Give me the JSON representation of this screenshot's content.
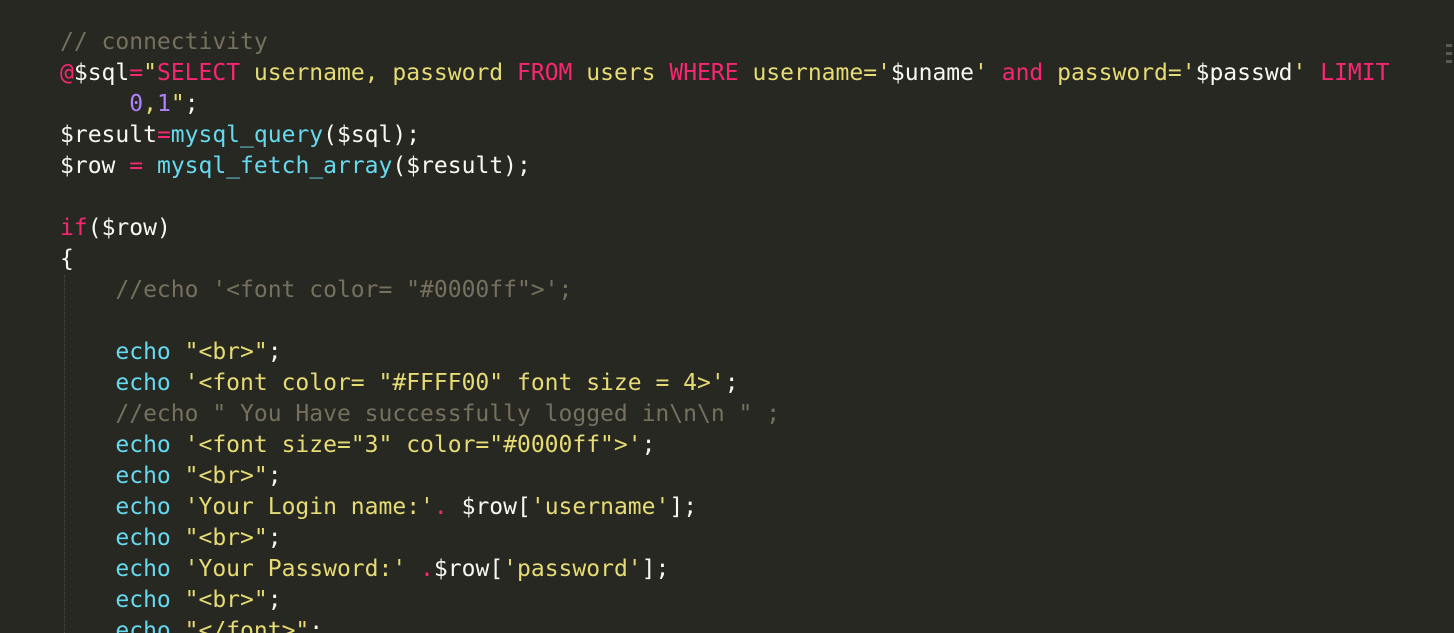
{
  "editor": {
    "theme_colors": {
      "background": "#272822",
      "foreground": "#f8f8f2",
      "comment": "#75715e",
      "keyword": "#f92672",
      "function": "#66d9ef",
      "string": "#e6db74",
      "number": "#ae81ff"
    },
    "lines": [
      {
        "tokens": [
          {
            "type": "comment",
            "text": "// connectivity"
          }
        ]
      },
      {
        "tokens": [
          {
            "type": "op",
            "text": "@"
          },
          {
            "type": "var",
            "text": "$sql"
          },
          {
            "type": "op",
            "text": "="
          },
          {
            "type": "string",
            "text": "\""
          },
          {
            "type": "keyword",
            "text": "SELECT"
          },
          {
            "type": "string",
            "text": " username, password "
          },
          {
            "type": "keyword",
            "text": "FROM"
          },
          {
            "type": "string",
            "text": " users "
          },
          {
            "type": "keyword",
            "text": "WHERE"
          },
          {
            "type": "string",
            "text": " username='"
          },
          {
            "type": "var",
            "text": "$uname"
          },
          {
            "type": "string",
            "text": "' "
          },
          {
            "type": "keyword",
            "text": "and"
          },
          {
            "type": "string",
            "text": " password='"
          },
          {
            "type": "var",
            "text": "$passwd"
          },
          {
            "type": "string",
            "text": "' "
          },
          {
            "type": "keyword",
            "text": "LIMIT"
          }
        ]
      },
      {
        "tokens": [
          {
            "type": "plain",
            "text": "     "
          },
          {
            "type": "number",
            "text": "0"
          },
          {
            "type": "string",
            "text": ","
          },
          {
            "type": "number",
            "text": "1"
          },
          {
            "type": "string",
            "text": "\""
          },
          {
            "type": "punct",
            "text": ";"
          }
        ]
      },
      {
        "tokens": [
          {
            "type": "var",
            "text": "$result"
          },
          {
            "type": "op",
            "text": "="
          },
          {
            "type": "func",
            "text": "mysql_query"
          },
          {
            "type": "punct",
            "text": "("
          },
          {
            "type": "var",
            "text": "$sql"
          },
          {
            "type": "punct",
            "text": ");"
          }
        ]
      },
      {
        "tokens": [
          {
            "type": "var",
            "text": "$row"
          },
          {
            "type": "plain",
            "text": " "
          },
          {
            "type": "op",
            "text": "="
          },
          {
            "type": "plain",
            "text": " "
          },
          {
            "type": "func",
            "text": "mysql_fetch_array"
          },
          {
            "type": "punct",
            "text": "("
          },
          {
            "type": "var",
            "text": "$result"
          },
          {
            "type": "punct",
            "text": ");"
          }
        ]
      },
      {
        "tokens": []
      },
      {
        "tokens": [
          {
            "type": "keyword",
            "text": "if"
          },
          {
            "type": "punct",
            "text": "("
          },
          {
            "type": "var",
            "text": "$row"
          },
          {
            "type": "punct",
            "text": ")"
          }
        ]
      },
      {
        "tokens": [
          {
            "type": "punct",
            "text": "{"
          }
        ]
      },
      {
        "tokens": [
          {
            "type": "plain",
            "text": "    "
          },
          {
            "type": "comment",
            "text": "//echo '<font color= \"#0000ff\">';"
          }
        ]
      },
      {
        "tokens": []
      },
      {
        "tokens": [
          {
            "type": "plain",
            "text": "    "
          },
          {
            "type": "func",
            "text": "echo"
          },
          {
            "type": "plain",
            "text": " "
          },
          {
            "type": "string",
            "text": "\"<br>\""
          },
          {
            "type": "punct",
            "text": ";"
          }
        ]
      },
      {
        "tokens": [
          {
            "type": "plain",
            "text": "    "
          },
          {
            "type": "func",
            "text": "echo"
          },
          {
            "type": "plain",
            "text": " "
          },
          {
            "type": "string",
            "text": "'<font color= \"#FFFF00\" font size = 4>'"
          },
          {
            "type": "punct",
            "text": ";"
          }
        ]
      },
      {
        "tokens": [
          {
            "type": "plain",
            "text": "    "
          },
          {
            "type": "comment",
            "text": "//echo \" You Have successfully logged in\\n\\n \" ;"
          }
        ]
      },
      {
        "tokens": [
          {
            "type": "plain",
            "text": "    "
          },
          {
            "type": "func",
            "text": "echo"
          },
          {
            "type": "plain",
            "text": " "
          },
          {
            "type": "string",
            "text": "'<font size=\"3\" color=\"#0000ff\">'"
          },
          {
            "type": "punct",
            "text": ";"
          }
        ]
      },
      {
        "tokens": [
          {
            "type": "plain",
            "text": "    "
          },
          {
            "type": "func",
            "text": "echo"
          },
          {
            "type": "plain",
            "text": " "
          },
          {
            "type": "string",
            "text": "\"<br>\""
          },
          {
            "type": "punct",
            "text": ";"
          }
        ]
      },
      {
        "tokens": [
          {
            "type": "plain",
            "text": "    "
          },
          {
            "type": "func",
            "text": "echo"
          },
          {
            "type": "plain",
            "text": " "
          },
          {
            "type": "string",
            "text": "'Your Login name:'"
          },
          {
            "type": "op",
            "text": "."
          },
          {
            "type": "plain",
            "text": " "
          },
          {
            "type": "var",
            "text": "$row"
          },
          {
            "type": "punct",
            "text": "["
          },
          {
            "type": "string",
            "text": "'username'"
          },
          {
            "type": "punct",
            "text": "];"
          }
        ]
      },
      {
        "tokens": [
          {
            "type": "plain",
            "text": "    "
          },
          {
            "type": "func",
            "text": "echo"
          },
          {
            "type": "plain",
            "text": " "
          },
          {
            "type": "string",
            "text": "\"<br>\""
          },
          {
            "type": "punct",
            "text": ";"
          }
        ]
      },
      {
        "tokens": [
          {
            "type": "plain",
            "text": "    "
          },
          {
            "type": "func",
            "text": "echo"
          },
          {
            "type": "plain",
            "text": " "
          },
          {
            "type": "string",
            "text": "'Your Password:'"
          },
          {
            "type": "plain",
            "text": " "
          },
          {
            "type": "op",
            "text": "."
          },
          {
            "type": "var",
            "text": "$row"
          },
          {
            "type": "punct",
            "text": "["
          },
          {
            "type": "string",
            "text": "'password'"
          },
          {
            "type": "punct",
            "text": "];"
          }
        ]
      },
      {
        "tokens": [
          {
            "type": "plain",
            "text": "    "
          },
          {
            "type": "func",
            "text": "echo"
          },
          {
            "type": "plain",
            "text": " "
          },
          {
            "type": "string",
            "text": "\"<br>\""
          },
          {
            "type": "punct",
            "text": ";"
          }
        ]
      },
      {
        "tokens": [
          {
            "type": "plain",
            "text": "    "
          },
          {
            "type": "func",
            "text": "echo"
          },
          {
            "type": "plain",
            "text": " "
          },
          {
            "type": "string",
            "text": "\"</font>\""
          },
          {
            "type": "punct",
            "text": ";"
          }
        ]
      }
    ]
  }
}
